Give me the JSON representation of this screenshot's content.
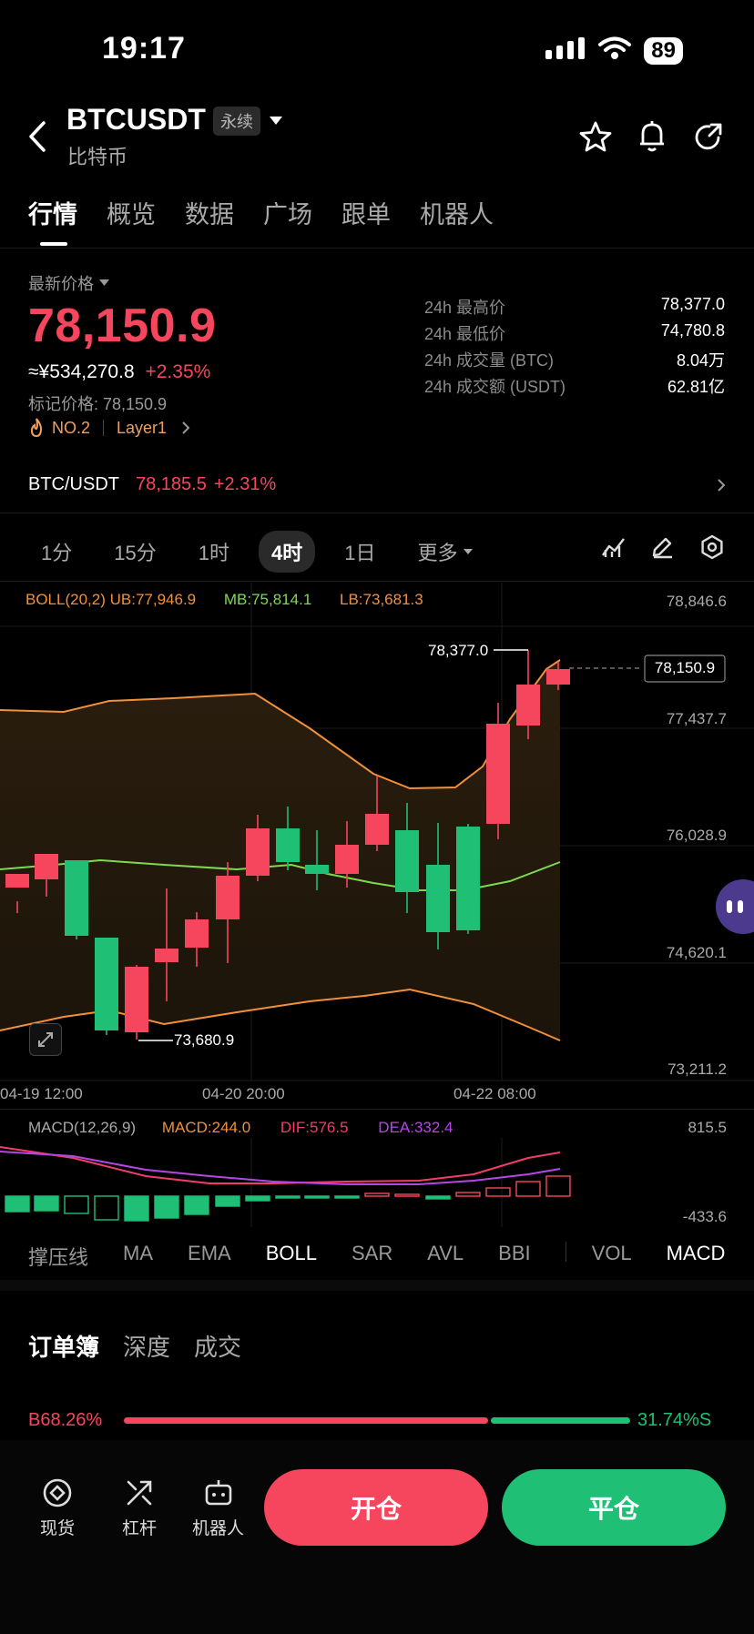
{
  "status": {
    "time": "19:17",
    "battery": "89"
  },
  "header": {
    "symbol": "BTCUSDT",
    "tag": "永续",
    "subtitle": "比特币"
  },
  "tabs": [
    "行情",
    "概览",
    "数据",
    "广场",
    "跟单",
    "机器人"
  ],
  "ticker": {
    "latest_label": "最新价格",
    "price": "78,150.9",
    "cny": "≈¥534,270.8",
    "change": "+2.35%",
    "mark_label": "标记价格: 78,150.9",
    "rank": "NO.2",
    "layer": "Layer1",
    "stats": [
      {
        "label": "24h 最高价",
        "value": "78,377.0"
      },
      {
        "label": "24h 最低价",
        "value": "74,780.8"
      },
      {
        "label": "24h 成交量 (BTC)",
        "value": "8.04万"
      },
      {
        "label": "24h 成交额 (USDT)",
        "value": "62.81亿"
      }
    ]
  },
  "spot": {
    "pair": "BTC/USDT",
    "price": "78,185.5",
    "change": "+2.31%"
  },
  "intervals": [
    "1分",
    "15分",
    "1时",
    "4时",
    "1日",
    "更多"
  ],
  "chart": {
    "boll_label": "BOLL(20,2)",
    "ub": "UB:77,946.9",
    "mb": "MB:75,814.1",
    "lb": "LB:73,681.3",
    "y_ticks": [
      "78,846.6",
      "77,437.7",
      "76,028.9",
      "74,620.1",
      "73,211.2"
    ],
    "x_ticks": [
      "04-19 12:00",
      "04-20 20:00",
      "04-22 08:00"
    ],
    "high_label": "78,377.0",
    "low_label": "73,680.9",
    "current_price": "78,150.9"
  },
  "macd": {
    "label": "MACD(12,26,9)",
    "macd": "MACD:244.0",
    "dif": "DIF:576.5",
    "dea": "DEA:332.4",
    "top": "815.5",
    "bottom": "-433.6"
  },
  "indicator_tabs": [
    "撑压线",
    "MA",
    "EMA",
    "BOLL",
    "SAR",
    "AVL",
    "BBI",
    "VOL",
    "MACD"
  ],
  "orderbook": {
    "tabs": [
      "订单簿",
      "深度",
      "成交"
    ],
    "buy": "68.26%",
    "sell": "31.74%",
    "buy_prefix": "B",
    "sell_suffix": "S"
  },
  "bottom": {
    "spot": "现货",
    "leverage": "杠杆",
    "bot": "机器人",
    "open": "开仓",
    "close": "平仓"
  },
  "colors": {
    "up": "#f6465d",
    "down": "#1fbf75",
    "ub": "#f0903a",
    "mb": "#7fd94e",
    "dif": "#f23c6a",
    "dea": "#b347e6"
  }
}
